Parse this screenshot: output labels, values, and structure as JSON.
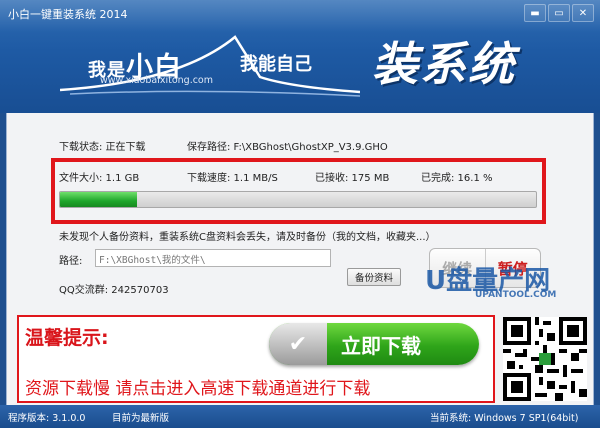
{
  "window": {
    "title": "小白一键重装系统 2014",
    "min_label": "▬",
    "restore_label": "▭",
    "close_label": "✕"
  },
  "logo": {
    "part1_small": "我是",
    "part1_big": "小白",
    "url": "www.xiaobaixitong.com",
    "part2": "我能自己",
    "part3": "装系统"
  },
  "download": {
    "status_label": "下载状态: 正在下载",
    "save_path_label": "保存路径: F:\\XBGhost\\GhostXP_V3.9.GHO",
    "size_label": "文件大小: 1.1 GB",
    "speed_label": "下载速度: 1.1 MB/S",
    "received_label": "已接收: 175 MB",
    "done_label": "已完成: 16.1 %",
    "progress_percent": 16.1
  },
  "backup": {
    "notice": "未发现个人备份资料，重装系统C盘资料会丢失，请及时备份（我的文档，收藏夹...）",
    "path_label": "路径:",
    "path_value": "F:\\XBGhost\\我的文件\\",
    "button_label": "备份资料",
    "qq_label": "QQ交流群: 242570703"
  },
  "controls": {
    "resume_label": "继续",
    "pause_label": "暂停"
  },
  "banner": {
    "tip_title": "温馨提示:",
    "download_button": "立即下载",
    "check_glyph": "✔",
    "slow_text": "资源下载慢 请点击进入高速下载通道进行下载"
  },
  "watermark": {
    "main": "U盘量产网",
    "sub": "UPANTOOL.COM"
  },
  "statusbar": {
    "version": "程序版本: 3.1.0.0",
    "latest": "目前为最新版",
    "os": "当前系统: Windows 7 SP1(64bit)"
  },
  "colors": {
    "accent_red": "#e0161b",
    "header_blue": "#1e5aa4",
    "progress_green": "#1fa62b"
  }
}
